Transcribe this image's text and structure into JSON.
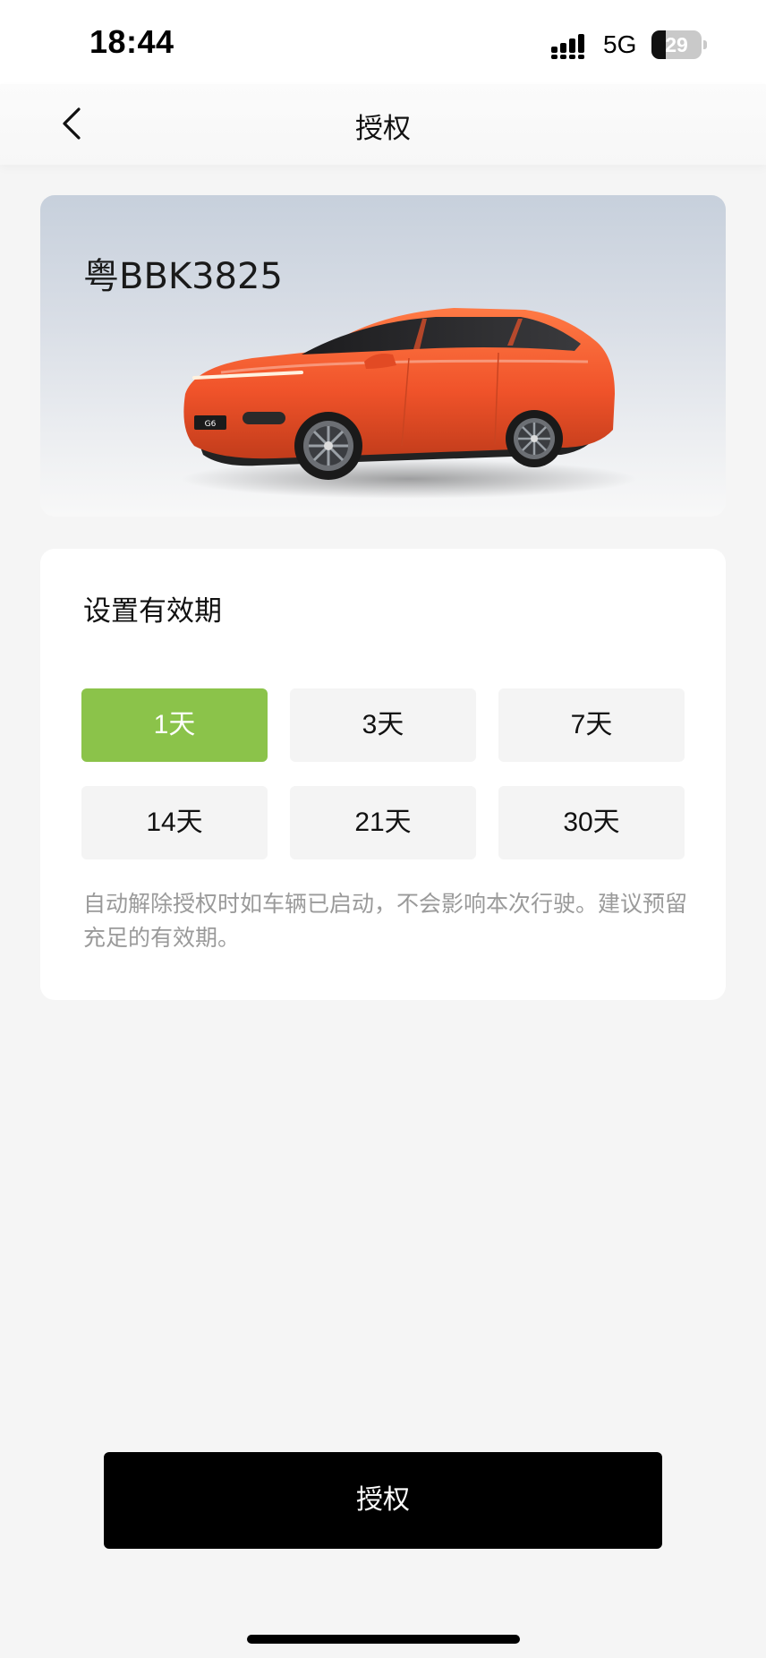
{
  "status_bar": {
    "time": "18:44",
    "network": "5G",
    "battery_level": "29",
    "battery_fraction": 0.29
  },
  "nav": {
    "title": "授权",
    "back_icon": "chevron-left-icon"
  },
  "vehicle": {
    "plate": "粤BBK3825",
    "badge": "G6",
    "body_color": "#f0532a"
  },
  "validity": {
    "title": "设置有效期",
    "options": [
      "1天",
      "3天",
      "7天",
      "14天",
      "21天",
      "30天"
    ],
    "selected": "1天",
    "note": "自动解除授权时如车辆已启动，不会影响本次行驶。建议预留充足的有效期。"
  },
  "action": {
    "authorize_label": "授权"
  },
  "colors": {
    "accent": "#8bc34a",
    "button": "#000000",
    "background": "#f5f5f5"
  }
}
